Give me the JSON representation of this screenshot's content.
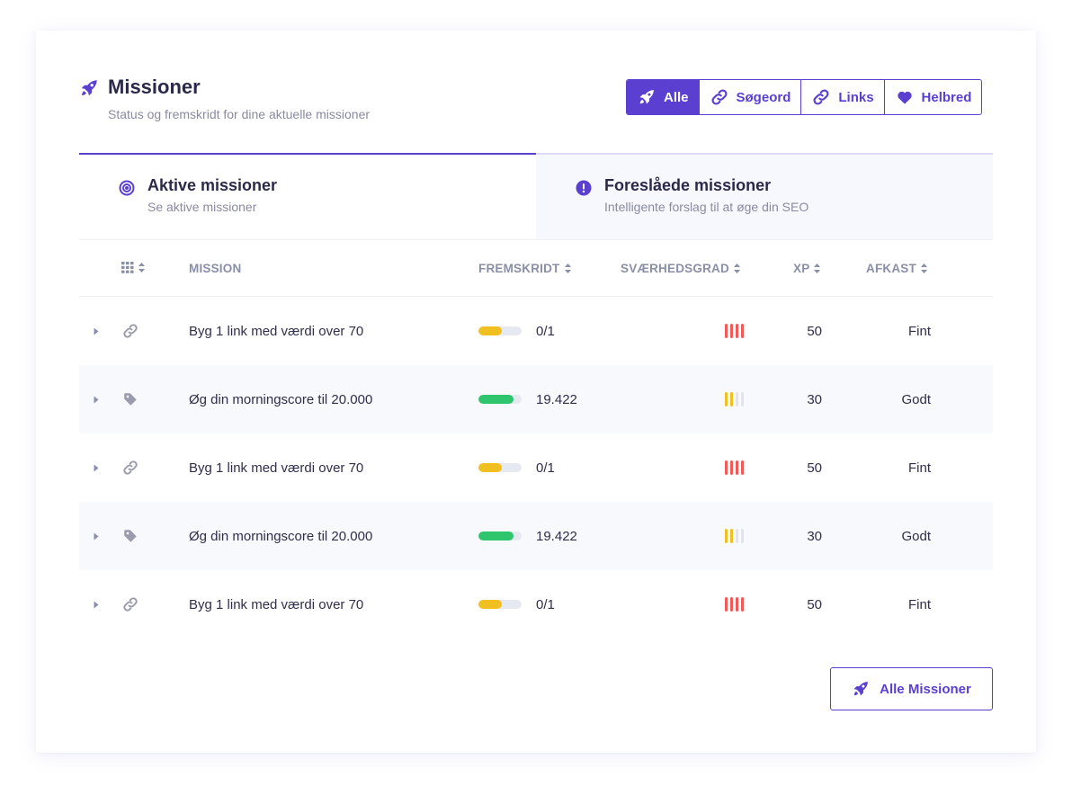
{
  "header": {
    "title": "Missioner",
    "subtitle": "Status og fremskridt for dine aktuelle missioner",
    "icon": "rocket-icon"
  },
  "filters": [
    {
      "label": "Alle",
      "icon": "rocket-icon",
      "active": true
    },
    {
      "label": "Søgeord",
      "icon": "link-icon",
      "active": false
    },
    {
      "label": "Links",
      "icon": "link-icon",
      "active": false
    },
    {
      "label": "Helbred",
      "icon": "heart-icon",
      "active": false
    }
  ],
  "tabs": [
    {
      "title": "Aktive missioner",
      "subtitle": "Se aktive missioner",
      "icon": "target-icon",
      "active": true
    },
    {
      "title": "Foreslåede missioner",
      "subtitle": "Intelligente forslag til at øge din SEO",
      "icon": "alert-icon",
      "active": false
    }
  ],
  "table": {
    "columns": {
      "mission": "MISSION",
      "progress": "FREMSKRIDT",
      "difficulty": "SVÆRHEDSGRAD",
      "xp": "XP",
      "return": "AFKAST"
    },
    "rows": [
      {
        "icon": "link-icon",
        "mission": "Byg 1 link med værdi over 70",
        "progress_text": "0/1",
        "progress_fraction": 0.55,
        "progress_color": "#f0c020",
        "difficulty_level": 4,
        "difficulty_color": "#f25a5a",
        "xp": "50",
        "return": "Fint"
      },
      {
        "icon": "tag-icon",
        "mission": "Øg din morningscore til 20.000",
        "progress_text": "19.422",
        "progress_fraction": 0.82,
        "progress_color": "#2fc56d",
        "difficulty_level": 2,
        "difficulty_color": "#f0c020",
        "xp": "30",
        "return": "Godt"
      },
      {
        "icon": "link-icon",
        "mission": "Byg 1 link med værdi over 70",
        "progress_text": "0/1",
        "progress_fraction": 0.55,
        "progress_color": "#f0c020",
        "difficulty_level": 4,
        "difficulty_color": "#f25a5a",
        "xp": "50",
        "return": "Fint"
      },
      {
        "icon": "tag-icon",
        "mission": "Øg din morningscore til 20.000",
        "progress_text": "19.422",
        "progress_fraction": 0.82,
        "progress_color": "#2fc56d",
        "difficulty_level": 2,
        "difficulty_color": "#f0c020",
        "xp": "30",
        "return": "Godt"
      },
      {
        "icon": "link-icon",
        "mission": "Byg 1 link med værdi over 70",
        "progress_text": "0/1",
        "progress_fraction": 0.55,
        "progress_color": "#f0c020",
        "difficulty_level": 4,
        "difficulty_color": "#f25a5a",
        "xp": "50",
        "return": "Fint"
      }
    ]
  },
  "footer": {
    "all_missions_label": "Alle Missioner",
    "icon": "rocket-icon"
  },
  "colors": {
    "accent": "#5b3fd0",
    "text": "#2a2949",
    "muted": "#8a8aa3"
  }
}
